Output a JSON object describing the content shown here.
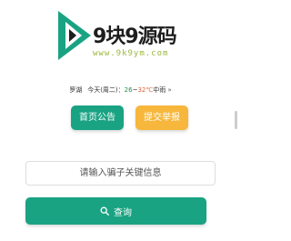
{
  "logo": {
    "title": "9块9源码",
    "subtitle": "www.9k9ym.com",
    "colors": {
      "green": "#1aa383",
      "lime": "#9ab83a",
      "dark": "#1e1e1e"
    }
  },
  "weather": {
    "city": "罗湖",
    "day": "今天(周二)：",
    "temp_low": "26",
    "separator": "~",
    "temp_high": "32℃",
    "condition": "中雨",
    "more": "»"
  },
  "buttons": {
    "notice_label": "首页公告",
    "report_label": "提交举报"
  },
  "search": {
    "placeholder": "请输入骗子关键信息",
    "button_label": "查询",
    "icon": "search-icon"
  },
  "colors": {
    "primary": "#1aa383",
    "accent": "#f6b73c"
  }
}
